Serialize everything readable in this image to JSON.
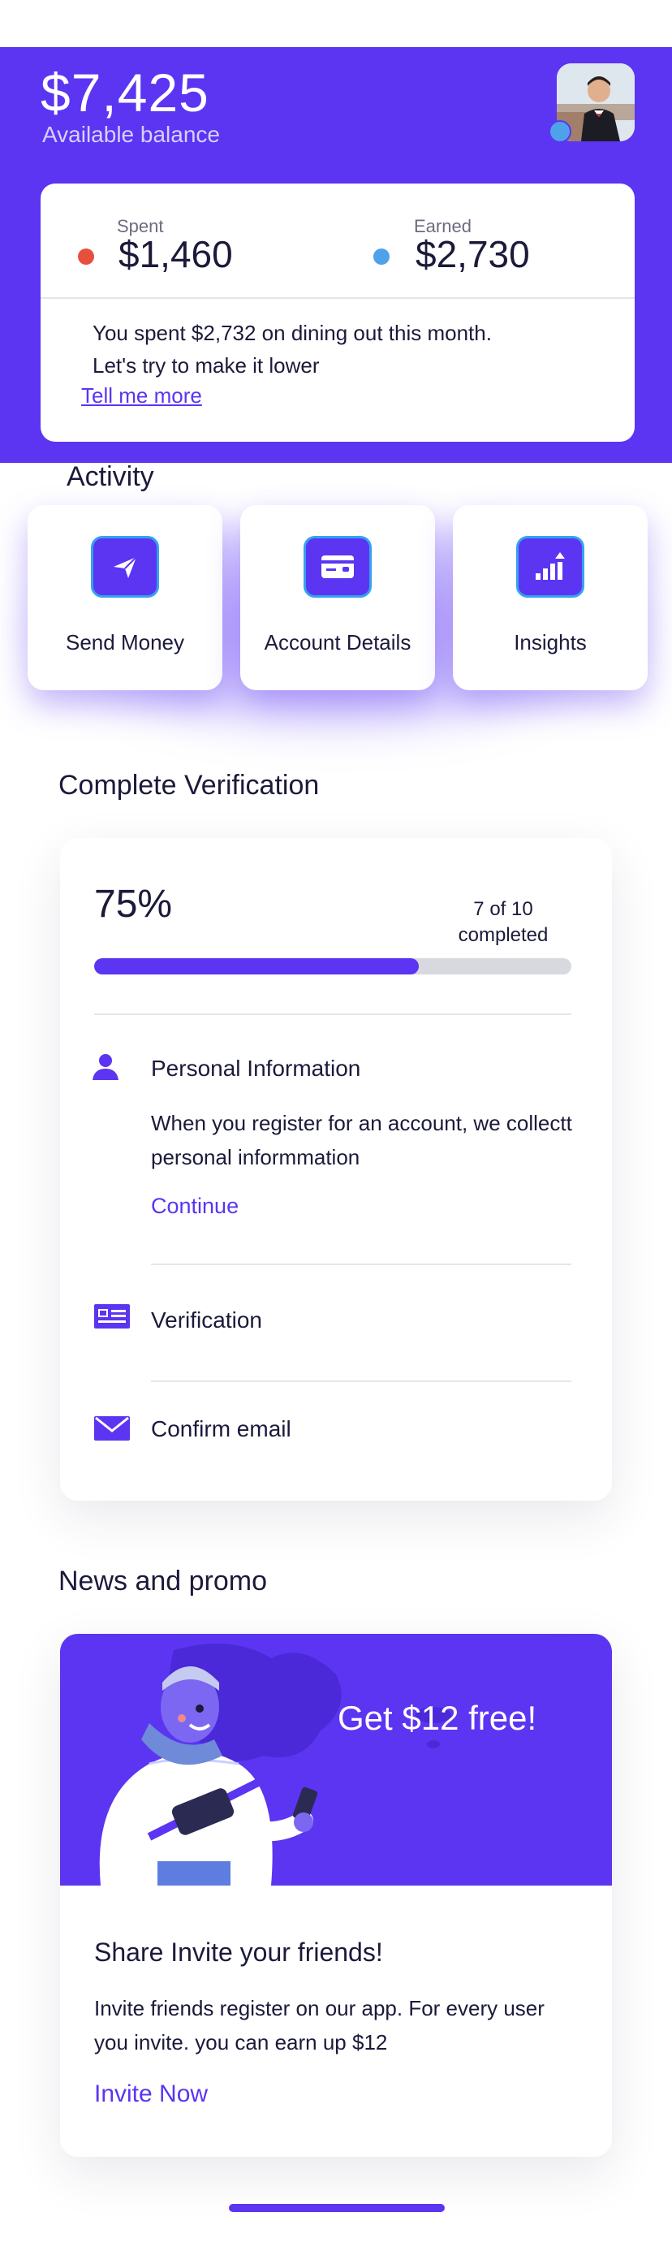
{
  "header": {
    "balance": "$7,425",
    "balance_label": "Available balance"
  },
  "summary": {
    "spent_label": "Spent",
    "spent_value": "$1,460",
    "earned_label": "Earned",
    "earned_value": "$2,730",
    "message_line1": "You spent $2,732 on dining out this month.",
    "message_line2": "Let's try to make it lower",
    "link": "Tell me more"
  },
  "activity": {
    "title": "Activity",
    "items": [
      {
        "label": "Send Money",
        "icon": "send-icon"
      },
      {
        "label": "Account Details",
        "icon": "card-icon"
      },
      {
        "label": "Insights",
        "icon": "chart-icon"
      }
    ]
  },
  "verification": {
    "title": "Complete Verification",
    "percent": "75%",
    "progress": 0.68,
    "count_line1": "7 of 10",
    "count_line2": "completed",
    "steps": [
      {
        "title": "Personal Information",
        "description": "When you register for an account, we collectt personal informmation",
        "action": "Continue",
        "icon": "person-icon"
      },
      {
        "title": "Verification",
        "icon": "id-card-icon"
      },
      {
        "title": "Confirm email",
        "icon": "mail-icon"
      }
    ]
  },
  "news": {
    "title": "News and promo",
    "promo": "Get $12 free!",
    "heading": "Share Invite your friends!",
    "text": "Invite friends register on our app. For every user you invite. you can earn up $12",
    "link": "Invite Now"
  },
  "colors": {
    "accent": "#5b35f2",
    "spent_dot": "#e8503e",
    "earned_dot": "#4fa2ea"
  }
}
